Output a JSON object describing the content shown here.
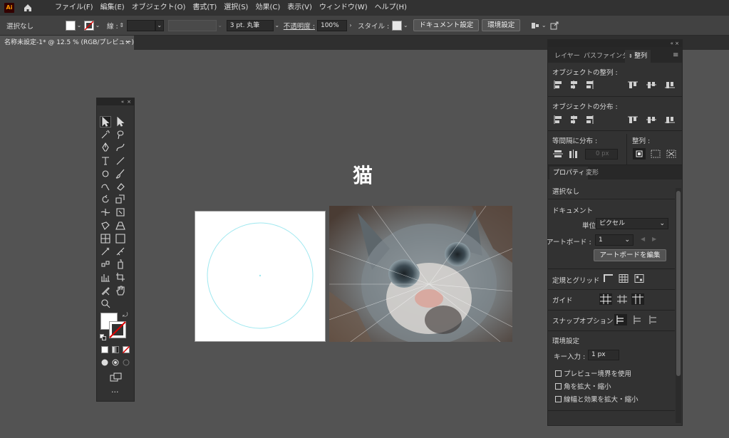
{
  "app": {
    "logo_text": "Ai"
  },
  "menu": [
    "ファイル(F)",
    "編集(E)",
    "オブジェクト(O)",
    "書式(T)",
    "選択(S)",
    "効果(C)",
    "表示(V)",
    "ウィンドウ(W)",
    "ヘルプ(H)"
  ],
  "control": {
    "selection": "選択なし",
    "stroke_label": "線 :",
    "stroke_style": "3 pt. 丸筆",
    "opacity_label": "不透明度 :",
    "opacity_value": "100%",
    "style_label": "スタイル :",
    "doc_setup": "ドキュメント設定",
    "prefs": "環境設定"
  },
  "document_tab": {
    "title": "名称未設定-1* @ 12.5 % (RGB/プレビュー)",
    "close": "×"
  },
  "canvas": {
    "title_text": "猫"
  },
  "right_panel": {
    "tabs": [
      "レイヤー",
      "パスファインダー",
      "整列"
    ],
    "align_objects": "オブジェクトの整列 :",
    "distribute_objects": "オブジェクトの分布 :",
    "distribute_spacing": "等間隔に分布 :",
    "align_to": "整列 :",
    "spacing_value": "0 px",
    "prop_tabs": [
      "プロパティ",
      "変形"
    ],
    "no_selection": "選択なし",
    "document": "ドキュメント",
    "unit_label": "単位 :",
    "unit_value": "ピクセル",
    "artboard_label": "アートボード :",
    "artboard_value": "1",
    "edit_artboards": "アートボードを編集",
    "rulers_grids": "定規とグリッド",
    "guides": "ガイド",
    "snap_options": "スナップオプション",
    "preferences": "環境設定",
    "key_increment_label": "キー入力 :",
    "key_increment_value": "1 px",
    "check_preview_bounds": "プレビュー境界を使用",
    "check_scale_corners": "角を拡大・縮小",
    "check_scale_strokes": "線幅と効果を拡大・縮小"
  },
  "colors": {
    "accent": "#ff9a00",
    "ui_dark": "#323232",
    "canvas": "#535353"
  }
}
